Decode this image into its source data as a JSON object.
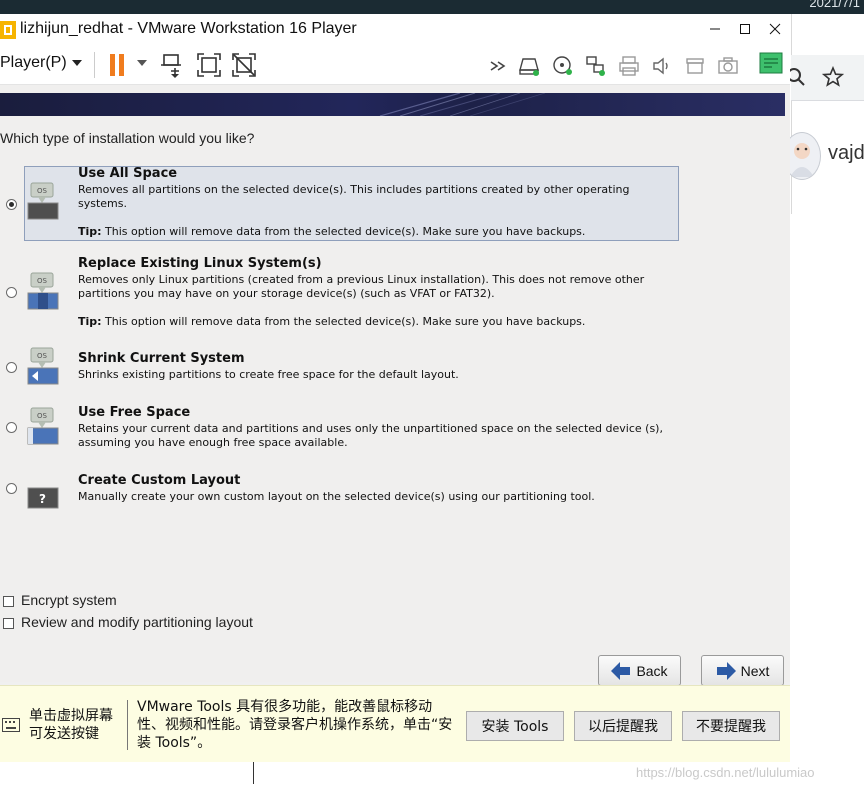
{
  "desktop": {
    "clock_partial": "2021/7/1"
  },
  "browser": {
    "user_partial": "vajd"
  },
  "window": {
    "title": "lizhijun_redhat - VMware Workstation 16 Player"
  },
  "toolbar": {
    "player_menu": "Player(P)"
  },
  "installer": {
    "question": "Which type of installation would you like?",
    "options": [
      {
        "title": "Use All Space",
        "description": "Removes all partitions on the selected device(s).  This includes partitions created by other operating systems.",
        "tip_label": "Tip:",
        "tip_text": " This option will remove data from the selected device(s).  Make sure you have backups.",
        "selected": true
      },
      {
        "title": "Replace Existing Linux System(s)",
        "description": "Removes only Linux partitions (created from a previous Linux installation).  This does not remove other partitions you may have on your storage device(s) (such as VFAT or FAT32).",
        "tip_label": "Tip:",
        "tip_text": " This option will remove data from the selected device(s).  Make sure you have backups.",
        "selected": false
      },
      {
        "title": "Shrink Current System",
        "description": "Shrinks existing partitions to create free space for the default layout.",
        "selected": false
      },
      {
        "title": "Use Free Space",
        "description": "Retains your current data and partitions and uses only the unpartitioned space on the selected device (s), assuming you have enough free space available.",
        "selected": false
      },
      {
        "title": "Create Custom Layout",
        "description": "Manually create your own custom layout on the selected device(s) using our partitioning tool.",
        "selected": false
      }
    ],
    "icon_label_os": "OS",
    "icon_label_custom": "?",
    "encrypt_label": "Encrypt system",
    "review_label": "Review and modify partitioning layout",
    "back_label": "Back",
    "next_label": "Next"
  },
  "notification": {
    "left_text": "单击虚拟屏幕可发送按键",
    "message": "VMware Tools 具有很多功能，能改善鼠标移动性、视频和性能。请登录客户机操作系统，单击“安装 Tools”。",
    "install_label": "安装 Tools",
    "later_label": "以后提醒我",
    "never_label": "不要提醒我"
  },
  "watermark": "https://blog.csdn.net/lululumiao",
  "colors": {
    "pause_orange": "#f07c1e",
    "selection_bg": "#dfe3ea",
    "selection_border": "#8f9fbb",
    "banner": "#1f2350",
    "notify_bg": "#fdfde2",
    "arrow_blue": "#2c5aa5"
  }
}
